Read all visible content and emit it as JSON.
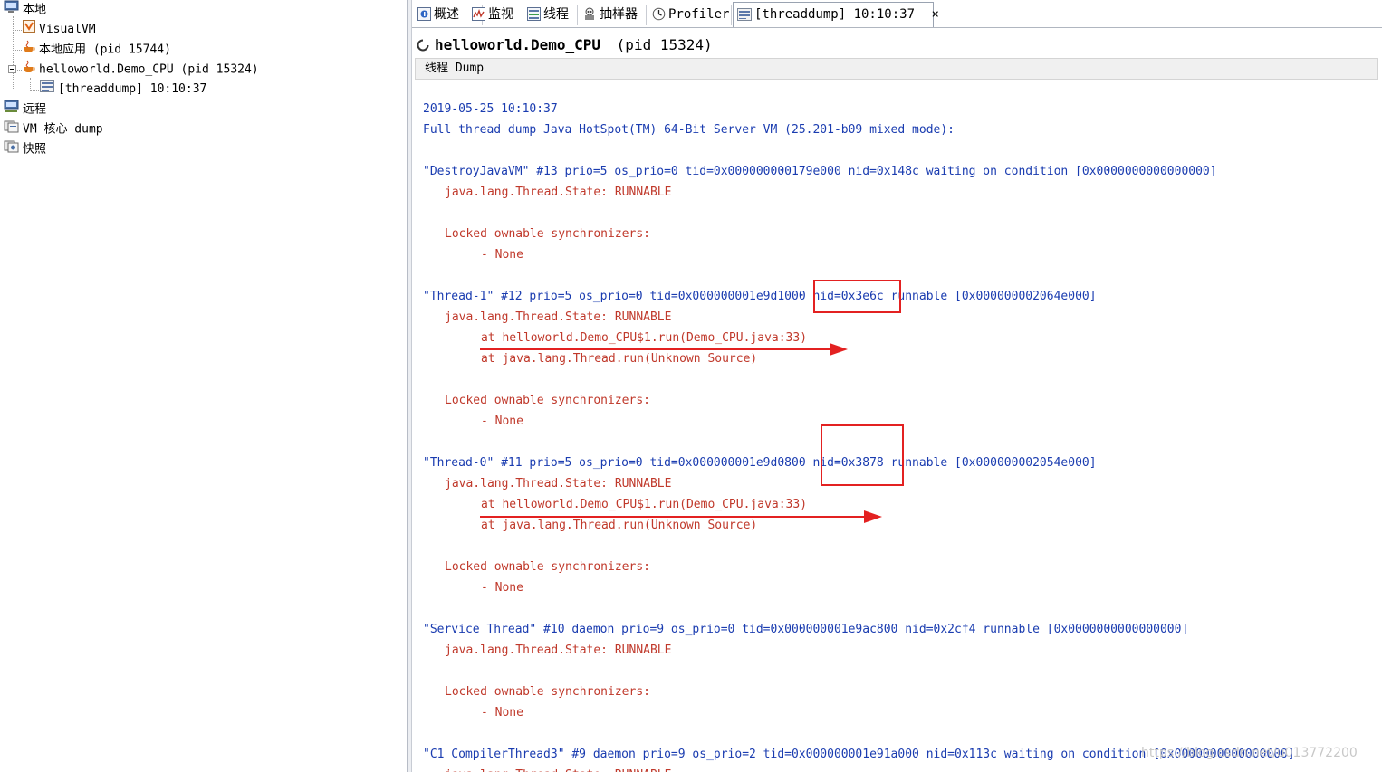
{
  "tree": {
    "local": "本地",
    "visualvm": "VisualVM",
    "local_app": "本地应用 (pid 15744)",
    "demo_cpu": "helloworld.Demo_CPU (pid 15324)",
    "threaddump": "[threaddump] 10:10:37",
    "remote": "远程",
    "vm_coredump": "VM 核心 dump",
    "snapshots": "快照"
  },
  "tabs": [
    {
      "label": "概述",
      "icon": "overview-icon"
    },
    {
      "label": "监视",
      "icon": "monitor-icon"
    },
    {
      "label": "线程",
      "icon": "threads-icon"
    },
    {
      "label": "抽样器",
      "icon": "sampler-icon"
    },
    {
      "label": "Profiler",
      "icon": "profiler-icon"
    },
    {
      "label": "[threaddump] 10:10:37",
      "icon": "threaddump-icon",
      "active": true
    }
  ],
  "tab_close": "×",
  "header": {
    "process_name": "helloworld.Demo_CPU",
    "pid": "(pid 15324)",
    "subtitle": "线程 Dump"
  },
  "dump": {
    "timestamp": "2019-05-25 10:10:37",
    "jvm_info": "Full thread dump Java HotSpot(TM) 64-Bit Server VM (25.201-b09 mixed mode):",
    "destroyjavavm_header": "\"DestroyJavaVM\" #13 prio=5 os_prio=0 tid=0x000000000179e000 nid=0x148c waiting on condition [0x0000000000000000]",
    "destroyjavavm_state": "java.lang.Thread.State: RUNNABLE",
    "destroyjavavm_locked": "Locked ownable synchronizers:",
    "destroyjavavm_none": "- None",
    "thread1_pre": "\"Thread-1\" #12 prio=5 os_prio=0 tid=0x000000001e9d1000 ",
    "thread1_nid": "nid=0x3e6c",
    "thread1_post": " runnable [0x000000002064e000]",
    "thread1_state": "java.lang.Thread.State: RUNNABLE",
    "thread1_frame1": "at helloworld.Demo_CPU$1.run(Demo_CPU.java:33)",
    "thread1_frame2": "at java.lang.Thread.run(Unknown Source)",
    "thread1_locked": "Locked ownable synchronizers:",
    "thread1_none": "- None",
    "thread0_pre": "\"Thread-0\" #11 prio=5 os_prio=0 tid=0x000000001e9d0800 ",
    "thread0_nid": "nid=0x3878",
    "thread0_post": " runnable [0x000000002054e000]",
    "thread0_state": "java.lang.Thread.State: RUNNABLE",
    "thread0_frame1": "at helloworld.Demo_CPU$1.run(Demo_CPU.java:33)",
    "thread0_frame2": "at java.lang.Thread.run(Unknown Source)",
    "thread0_locked": "Locked ownable synchronizers:",
    "thread0_none": "- None",
    "service_header": "\"Service Thread\" #10 daemon prio=9 os_prio=0 tid=0x000000001e9ac800 nid=0x2cf4 runnable [0x0000000000000000]",
    "service_state": "java.lang.Thread.State: RUNNABLE",
    "service_locked": "Locked ownable synchronizers:",
    "service_none": "- None",
    "c1_header": "\"C1 CompilerThread3\" #9 daemon prio=9 os_prio=2 tid=0x000000001e91a000 nid=0x113c waiting on condition [0x0000000000000000]",
    "c1_state": "java.lang.Thread.State: RUNNABLE"
  },
  "watermark": "https://blog.csdn.net/u013772200",
  "colors": {
    "thread_header": "#1a3cb0",
    "thread_body": "#c0392b",
    "annotation": "#e32121"
  }
}
